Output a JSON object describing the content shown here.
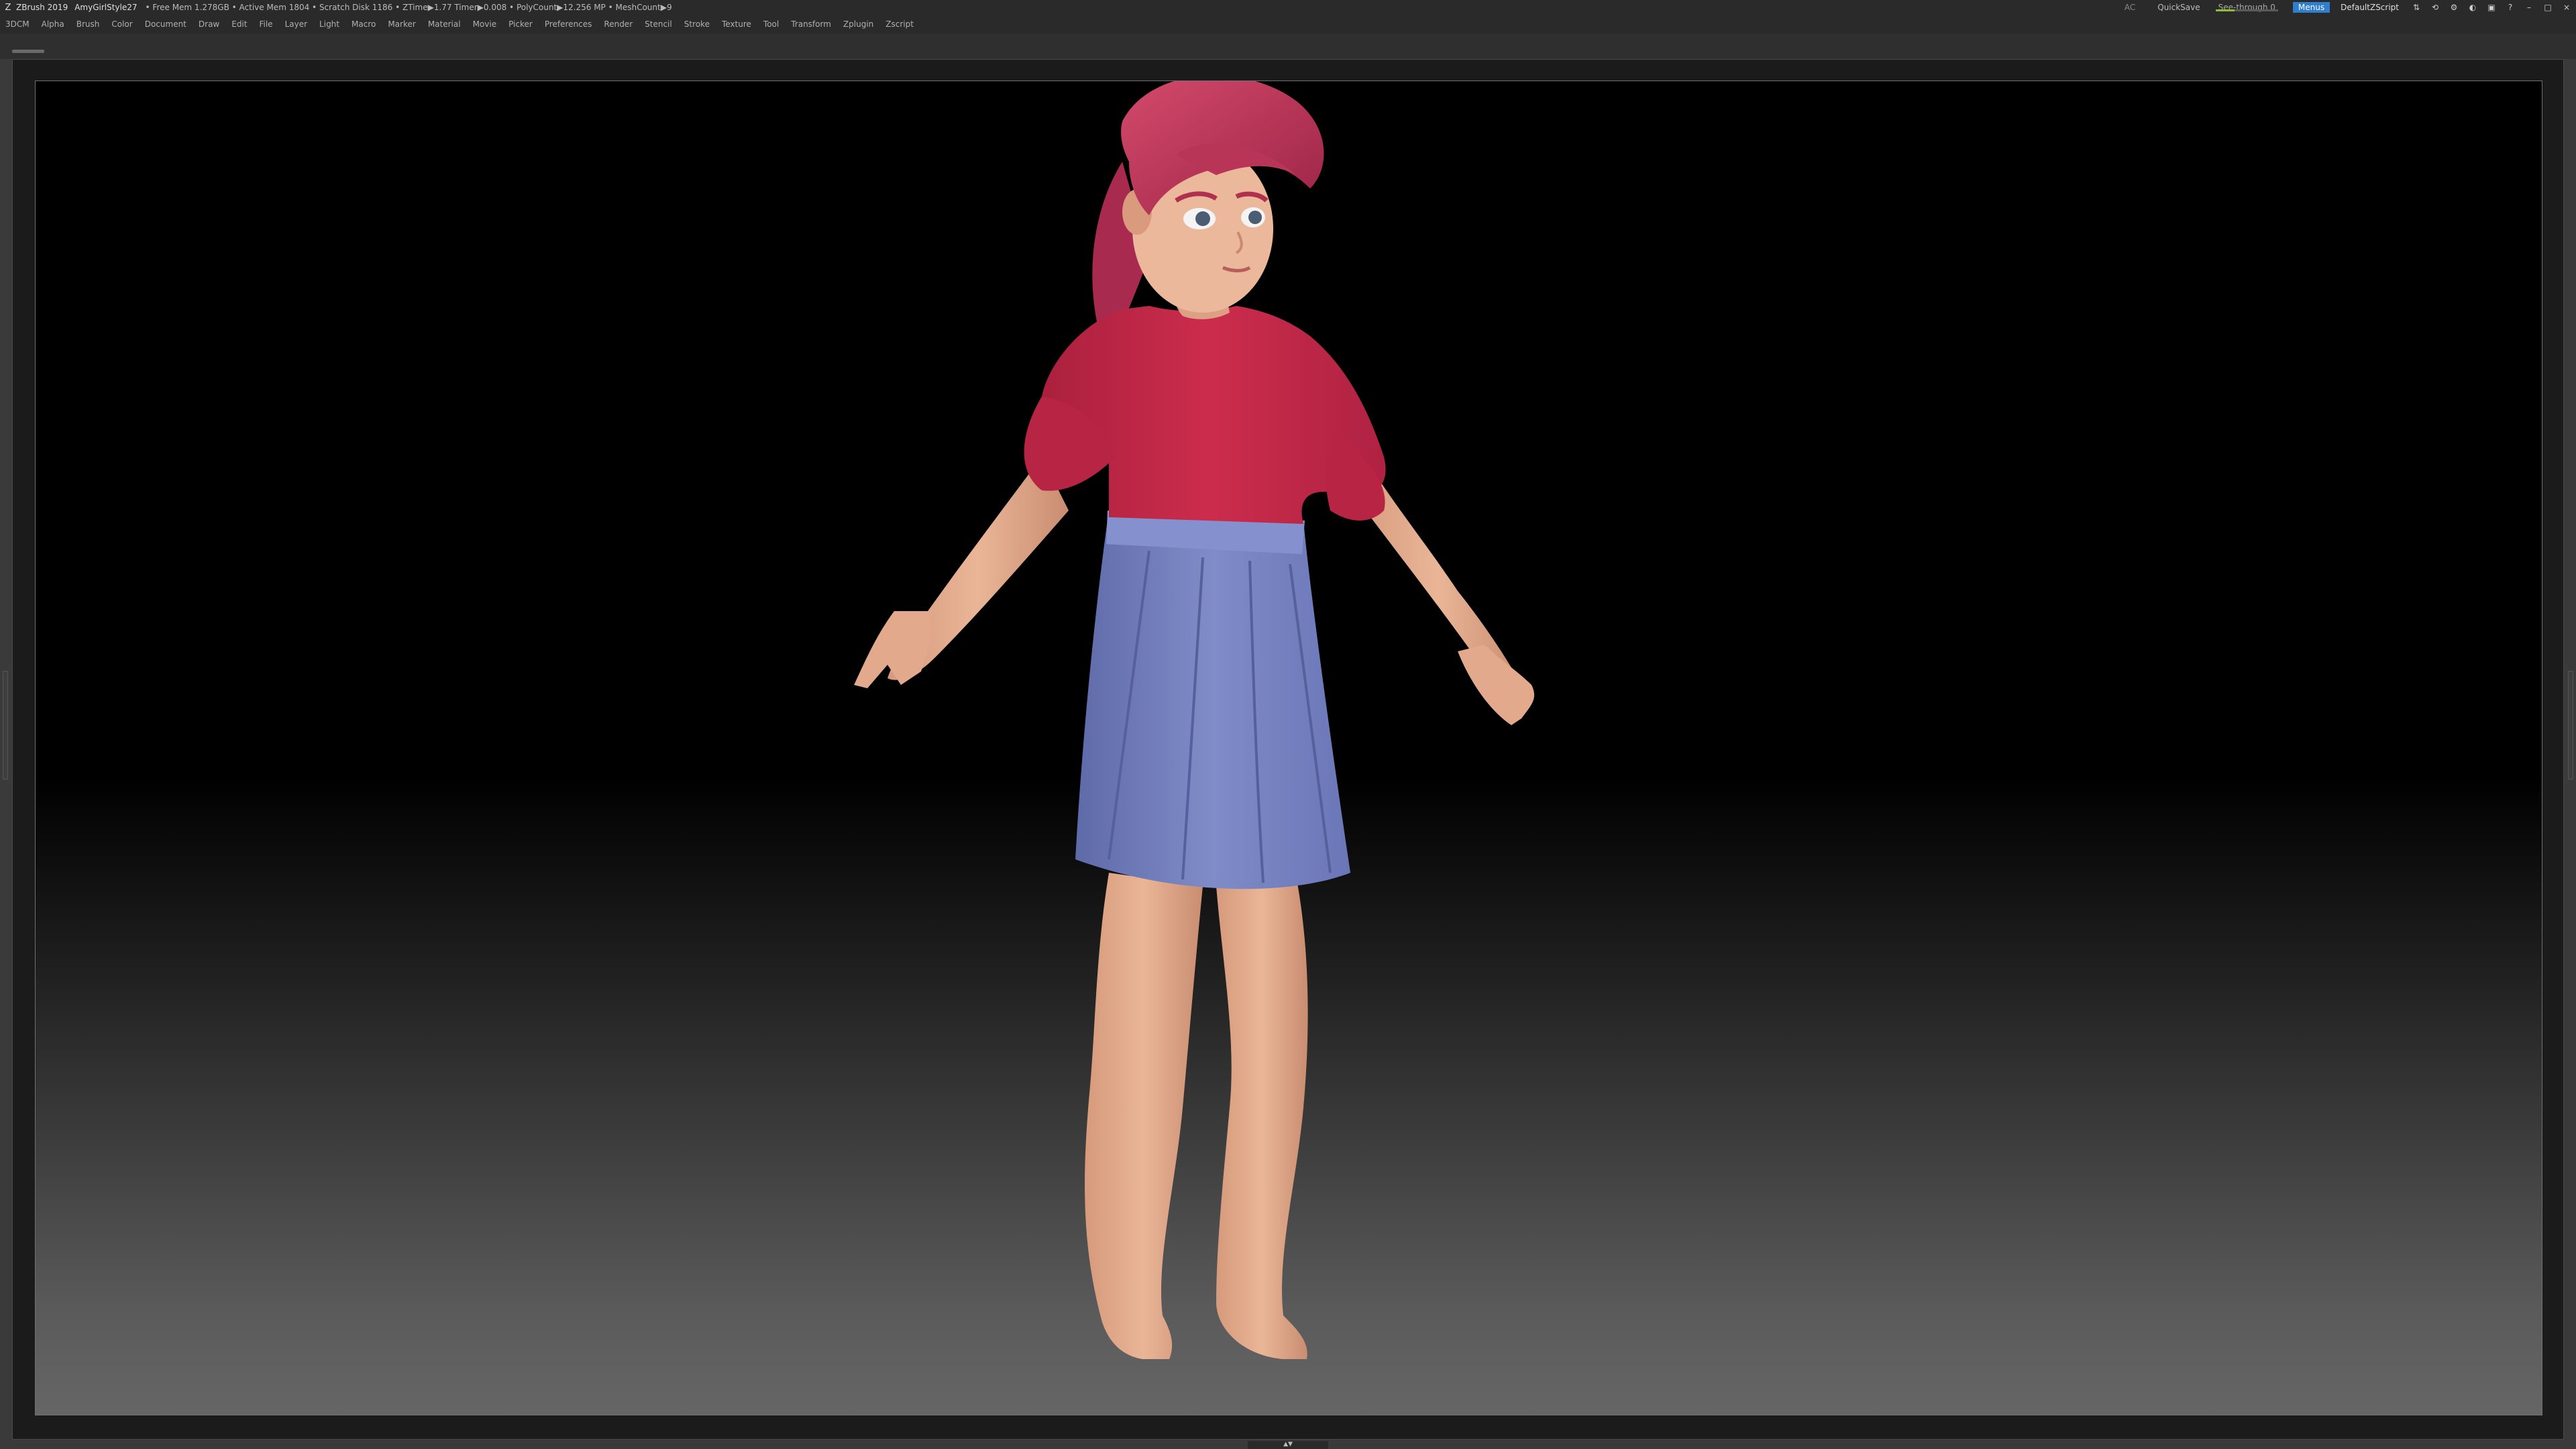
{
  "titlebar": {
    "app_name": "ZBrush 2019",
    "document": "AmyGirlStyle27",
    "stats": "• Free Mem 1.278GB • Active Mem 1804 • Scratch Disk 1186 • ZTime▶1.77 Timer▶0.008 • PolyCount▶12.256 MP • MeshCount▶9",
    "ac_label": "AC",
    "quicksave_label": "QuickSave",
    "see_through_label": "See-through 0",
    "menus_label": "Menus",
    "default_script_label": "DefaultZScript"
  },
  "menubar": {
    "items": [
      "3DCM",
      "Alpha",
      "Brush",
      "Color",
      "Document",
      "Draw",
      "Edit",
      "File",
      "Layer",
      "Light",
      "Macro",
      "Marker",
      "Material",
      "Movie",
      "Picker",
      "Preferences",
      "Render",
      "Stencil",
      "Stroke",
      "Texture",
      "Tool",
      "Transform",
      "Zplugin",
      "Zscript"
    ]
  },
  "colors": {
    "hair": "#c2365a",
    "top": "#c62848",
    "skirt": "#7a86c4",
    "skin": "#e8b093",
    "accent": "#2f7ed0"
  }
}
